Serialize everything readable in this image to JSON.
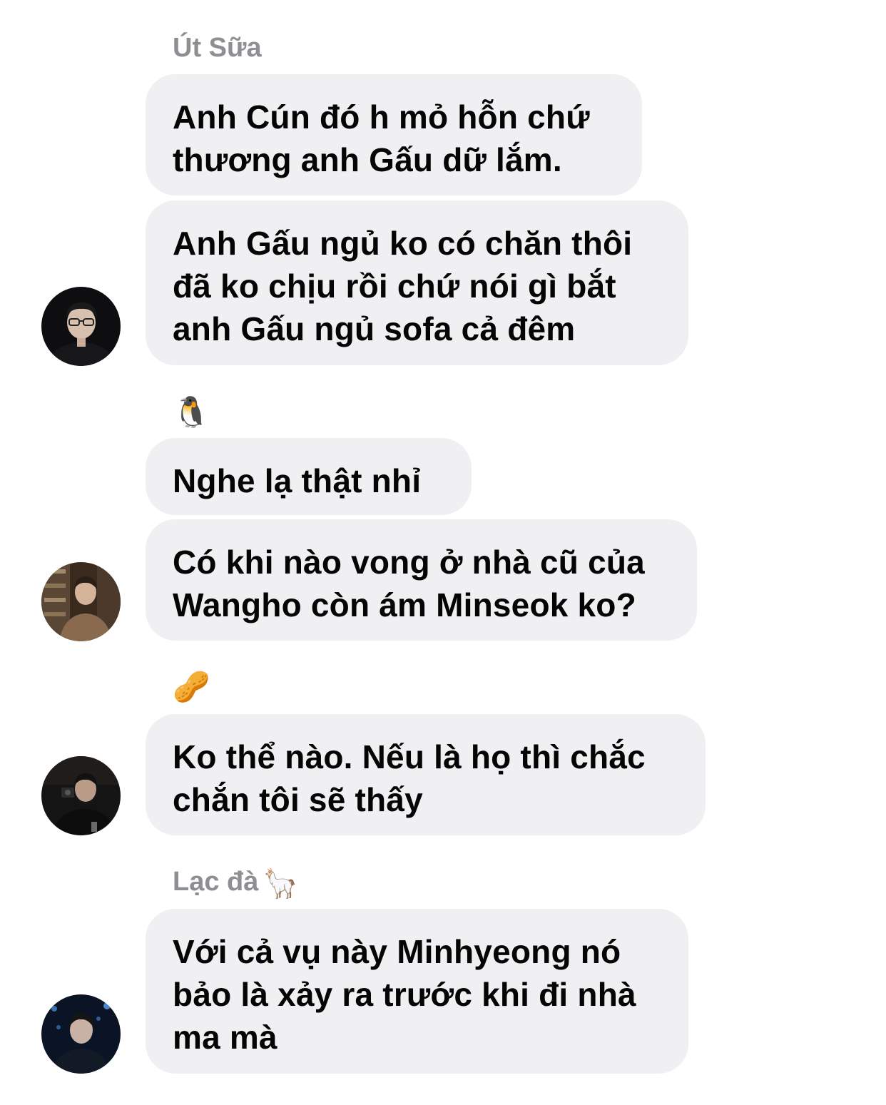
{
  "messages": [
    {
      "sender": "Út Sữa",
      "bubbles": [
        {
          "lines": [
            "Anh Cún đó h mỏ hỗn chứ",
            "thương anh Gấu dữ lắm."
          ]
        },
        {
          "lines": [
            "Anh Gấu ngủ ko có chăn thôi",
            "đã ko chịu rồi chứ nói gì bắt",
            "anh Gấu ngủ sofa cả đêm"
          ]
        }
      ]
    },
    {
      "sender_emoji": "🐧",
      "bubbles": [
        {
          "lines": [
            "Nghe lạ thật nhỉ"
          ]
        },
        {
          "lines": [
            "Có khi nào vong ở nhà cũ của",
            "Wangho còn ám Minseok ko?"
          ]
        }
      ]
    },
    {
      "sender_emoji": "🥜",
      "bubbles": [
        {
          "lines": [
            "Ko thể nào. Nếu là họ thì chắc",
            "chắn tôi sẽ thấy"
          ]
        }
      ]
    },
    {
      "sender": "Lạc đà",
      "sender_emoji": "🦙",
      "bubbles": [
        {
          "lines": [
            "Với cả vụ này Minhyeong nó",
            "bảo là xảy ra trước khi đi nhà",
            "ma mà"
          ]
        }
      ]
    }
  ],
  "colors": {
    "bubble_bg": "#f0f0f2",
    "sender_name": "#8e8e93",
    "message_text": "#050505"
  }
}
